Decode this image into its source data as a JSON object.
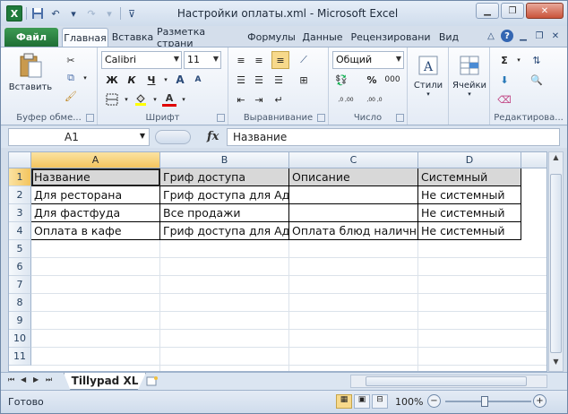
{
  "window": {
    "title": "Настройки оплаты.xml - Microsoft Excel",
    "app_icon": "X"
  },
  "quick_access": [
    "save-icon",
    "undo-icon",
    "redo-icon",
    "customize-icon"
  ],
  "tabs": [
    {
      "label": "Файл"
    },
    {
      "label": "Главная"
    },
    {
      "label": "Вставка"
    },
    {
      "label": "Разметка страни"
    },
    {
      "label": "Формулы"
    },
    {
      "label": "Данные"
    },
    {
      "label": "Рецензировани"
    },
    {
      "label": "Вид"
    }
  ],
  "ribbon": {
    "clipboard": {
      "paste_label": "Вставить",
      "group": "Буфер обме..."
    },
    "font": {
      "name": "Calibri",
      "size": "11",
      "group": "Шрифт",
      "bold": "Ж",
      "italic": "К",
      "underline": "Ч",
      "font_color": "A",
      "increase": "A",
      "decrease": "A"
    },
    "alignment": {
      "group": "Выравнивание"
    },
    "number": {
      "format": "Общий",
      "percent": "%",
      "thousands": "000",
      "dec_inc": ",0 ,00",
      "dec_dec": ",00 ,0",
      "group": "Число"
    },
    "styles": {
      "label": "Стили"
    },
    "cells": {
      "label": "Ячейки"
    },
    "editing": {
      "group": "Редактирова...",
      "sum": "Σ"
    }
  },
  "formula_bar": {
    "cell_ref": "A1",
    "fx": "fx",
    "value": "Название"
  },
  "sheet": {
    "columns": [
      "A",
      "B",
      "C",
      "D"
    ],
    "rows": [
      "1",
      "2",
      "3",
      "4",
      "5",
      "6",
      "7",
      "8",
      "9",
      "10",
      "11"
    ],
    "header": [
      "Название",
      "Гриф доступа",
      "Описание",
      "Системный"
    ],
    "data": [
      [
        "Для ресторана",
        "Гриф доступа для Адм",
        "",
        "Не системный"
      ],
      [
        "Для фастфуда",
        "Все продажи",
        "",
        "Не системный"
      ],
      [
        "Оплата в кафе",
        "Гриф доступа для Адм",
        "Оплата блюд наличн",
        "Не системный"
      ]
    ],
    "tab_name": "Tillypad XL"
  },
  "status": {
    "ready": "Готово",
    "zoom": "100%"
  },
  "colors": {
    "file_tab": "#1f6f35",
    "selection": "#f3c45e",
    "header_fill": "#d8d8d8"
  }
}
